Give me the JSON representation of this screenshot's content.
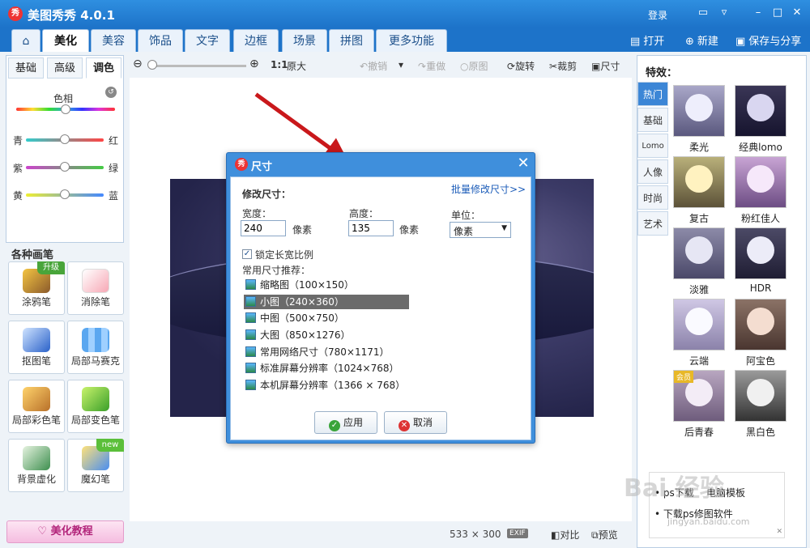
{
  "window": {
    "logo_text": "秀",
    "title": "美图秀秀 4.0.1",
    "login": "登录",
    "icons": [
      "chat-icon",
      "dropdown-icon",
      "minimize-icon",
      "maximize-icon",
      "close-icon"
    ]
  },
  "menu": {
    "tabs": [
      "美化",
      "美容",
      "饰品",
      "文字",
      "边框",
      "场景",
      "拼图",
      "更多功能"
    ],
    "active_tab": "美化",
    "more_caret": "▾",
    "open": "打开",
    "new": "新建",
    "save_share": "保存与分享"
  },
  "left": {
    "subtabs": [
      "基础",
      "高级",
      "调色"
    ],
    "active_subtab": "调色",
    "hue_label": "色相",
    "pairs": [
      {
        "left": "青",
        "right": "红"
      },
      {
        "left": "紫",
        "right": "绿"
      },
      {
        "left": "黄",
        "right": "蓝"
      }
    ],
    "brush_title": "各种画笔",
    "brushes": [
      {
        "label": "涂鸦笔",
        "badge": "升级"
      },
      {
        "label": "消除笔",
        "badge": ""
      },
      {
        "label": "抠图笔",
        "badge": ""
      },
      {
        "label": "局部马赛克",
        "badge": ""
      },
      {
        "label": "局部彩色笔",
        "badge": ""
      },
      {
        "label": "局部变色笔",
        "badge": ""
      },
      {
        "label": "背景虚化",
        "badge": ""
      },
      {
        "label": "魔幻笔",
        "badge": "new"
      }
    ],
    "tutorial": "美化教程"
  },
  "toolbar": {
    "zoom_ratio": "1:1",
    "original_size": "原大",
    "undo": "撤销",
    "redo": "重做",
    "original": "原图",
    "rotate": "旋转",
    "crop": "裁剪",
    "size": "尺寸",
    "zoom_level": 0.0
  },
  "status": {
    "dimensions": "533 × 300",
    "exif": "EXIF",
    "compare": "对比",
    "preview": "预览"
  },
  "right": {
    "title": "特效：",
    "categories": [
      "热门",
      "基础",
      "Lomo",
      "人像",
      "时尚",
      "艺术"
    ],
    "active_category": "热门",
    "effects": [
      "柔光",
      "经典lomo",
      "复古",
      "粉红佳人",
      "淡雅",
      "HDR",
      "云端",
      "阿宝色",
      "后青春",
      "黑白色"
    ],
    "effect_badge": "会员",
    "ad": {
      "line1": "ps下载",
      "line2": "电脑模板",
      "line3": "下载ps修图软件"
    }
  },
  "dialog": {
    "logo_text": "秀",
    "title": "尺寸",
    "section": "修改尺寸：",
    "batch_link": "批量修改尺寸>>",
    "width_label": "宽度：",
    "width_value": "240",
    "width_unit": "像素",
    "height_label": "高度：",
    "height_value": "135",
    "height_unit": "像素",
    "unit_label": "单位：",
    "unit_value": "像素",
    "lock_ratio": "锁定长宽比例",
    "lock_checked": true,
    "presets_label": "常用尺寸推荐：",
    "presets": [
      "缩略图（100×150）",
      "小图（240×360）",
      "中图（500×750）",
      "大图（850×1276）",
      "常用网络尺寸（780×1171）",
      "标准屏幕分辨率（1024×768）",
      "本机屏幕分辨率（1366 × 768）"
    ],
    "selected_preset_index": 1,
    "apply": "应用",
    "cancel": "取消"
  },
  "watermark": {
    "text": "Bai 经验",
    "sub": "jingyan.baidu.com"
  }
}
